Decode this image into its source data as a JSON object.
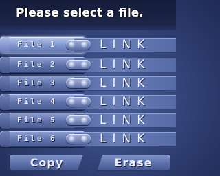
{
  "header": {
    "prompt": "Please select a file."
  },
  "files": [
    {
      "label": "File 1",
      "name": "LINK"
    },
    {
      "label": "File 2",
      "name": "LINK"
    },
    {
      "label": "File 3",
      "name": "LINK"
    },
    {
      "label": "File 4",
      "name": "LINK"
    },
    {
      "label": "File 5",
      "name": "LINK"
    },
    {
      "label": "File 6",
      "name": "LINK"
    }
  ],
  "selected_file": "File 1",
  "actions": {
    "copy": "Copy",
    "erase": "Erase"
  }
}
